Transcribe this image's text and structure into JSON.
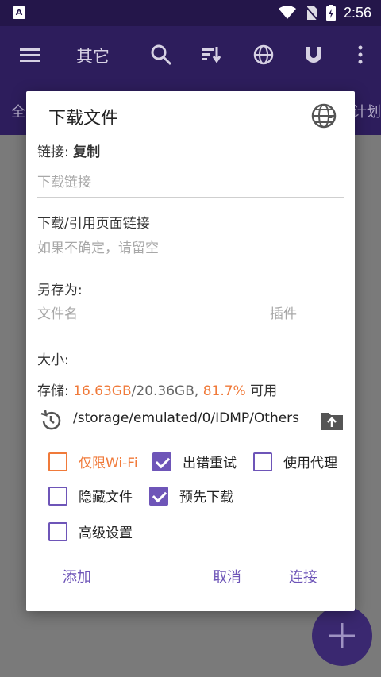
{
  "status": {
    "time": "2:56"
  },
  "appbar": {
    "title": "其它"
  },
  "tabs": {
    "left": "全",
    "right": "计划"
  },
  "dialog": {
    "title": "下载文件",
    "link_label": "链接:",
    "link_copy": "复制",
    "link_placeholder": "下载链接",
    "ref_label": "下载/引用页面链接",
    "ref_placeholder": "如果不确定，请留空",
    "saveas_label": "另存为:",
    "filename_placeholder": "文件名",
    "plugin_placeholder": "插件",
    "size_label": "大小:",
    "storage_label": "存储:",
    "storage_free": "16.63GB",
    "storage_total": "/20.36GB,",
    "storage_percent": "81.7%",
    "storage_suffix": "可用",
    "path": "/storage/emulated/0/IDMP/Others",
    "options": {
      "wifi_only": "仅限Wi-Fi",
      "retry_on_error": "出错重试",
      "use_proxy": "使用代理",
      "hide_file": "隐藏文件",
      "pre_download": "预先下载",
      "advanced": "高级设置"
    },
    "buttons": {
      "add": "添加",
      "cancel": "取消",
      "connect": "连接"
    }
  },
  "colors": {
    "accent": "#6e55b8",
    "orange": "#f07a3a",
    "appbar": "#2d1d5c"
  }
}
